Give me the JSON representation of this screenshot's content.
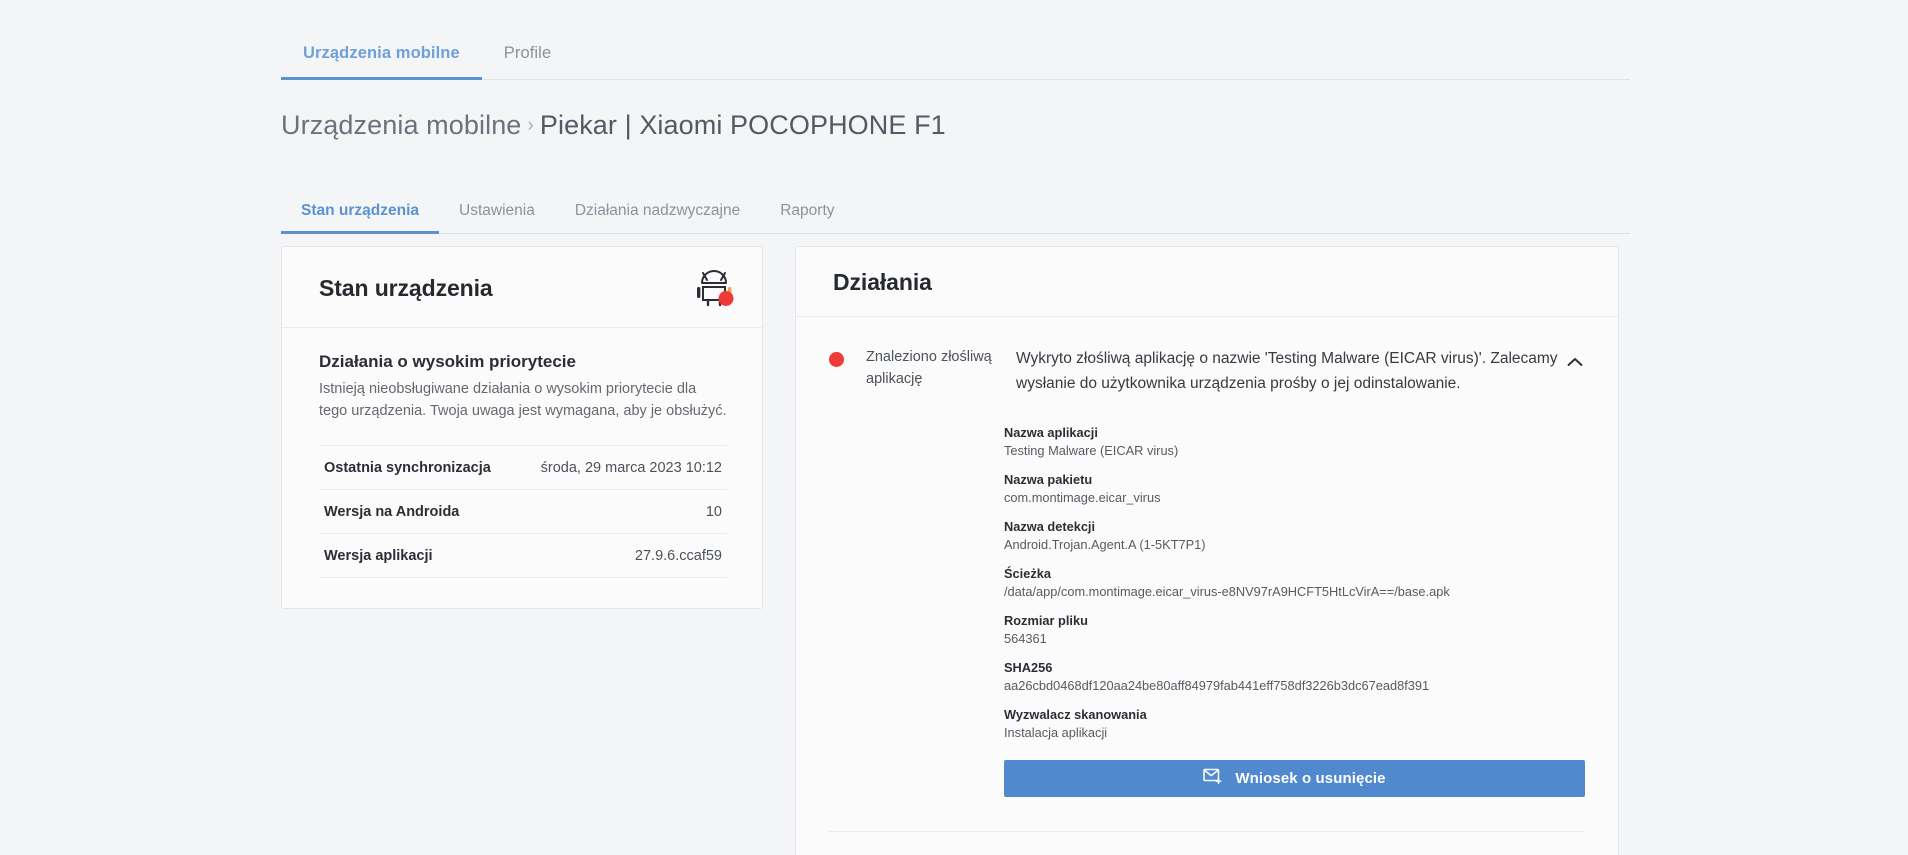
{
  "top_tabs": [
    {
      "label": "Urządzenia mobilne",
      "active": true
    },
    {
      "label": "Profile",
      "active": false
    }
  ],
  "breadcrumb": {
    "root": "Urządzenia mobilne",
    "separator": "›",
    "current": "Piekar | Xiaomi POCOPHONE F1"
  },
  "sub_tabs": [
    {
      "label": "Stan urządzenia",
      "active": true
    },
    {
      "label": "Ustawienia",
      "active": false
    },
    {
      "label": "Działania nadzwyczajne",
      "active": false
    },
    {
      "label": "Raporty",
      "active": false
    }
  ],
  "device_status_card": {
    "title": "Stan urządzenia",
    "icon": "android-robot-icon",
    "status_dot_color": "#ee3a34",
    "high_priority": {
      "title": "Działania o wysokim priorytecie",
      "description": "Istnieją nieobsługiwane działania o wysokim priorytecie dla tego urządzenia. Twoja uwaga jest wymagana, aby je obsłużyć."
    },
    "rows": [
      {
        "key": "Ostatnia synchronizacja",
        "value": "środa, 29 marca 2023 10:12"
      },
      {
        "key": "Wersja na Androida",
        "value": "10"
      },
      {
        "key": "Wersja aplikacji",
        "value": "27.9.6.ccaf59"
      }
    ]
  },
  "actions_card": {
    "title": "Działania",
    "severity_color": "#ee3a34",
    "action": {
      "label": "Znaleziono złośliwą aplikację",
      "description": "Wykryto złośliwą aplikację o nazwie 'Testing Malware (EICAR virus)'. Zalecamy wysłanie do użytkownika urządzenia prośby o jej odinstalowanie.",
      "collapse_icon": "chevron-up-icon",
      "details": [
        {
          "label": "Nazwa aplikacji",
          "value": "Testing Malware (EICAR virus)"
        },
        {
          "label": "Nazwa pakietu",
          "value": "com.montimage.eicar_virus"
        },
        {
          "label": "Nazwa detekcji",
          "value": "Android.Trojan.Agent.A (1-5KT7P1)"
        },
        {
          "label": "Ścieżka",
          "value": "/data/app/com.montimage.eicar_virus-e8NV97rA9HCFT5HtLcVirA==/base.apk"
        },
        {
          "label": "Rozmiar pliku",
          "value": "564361"
        },
        {
          "label": "SHA256",
          "value": "aa26cbd0468df120aa24be80aff84979fab441eff758df3226b3dc67ead8f391"
        },
        {
          "label": "Wyzwalacz skanowania",
          "value": "Instalacja aplikacji"
        }
      ],
      "button": {
        "label": "Wniosek o usunięcie",
        "icon": "envelope-plus-icon",
        "color": "#5189ce"
      }
    }
  }
}
